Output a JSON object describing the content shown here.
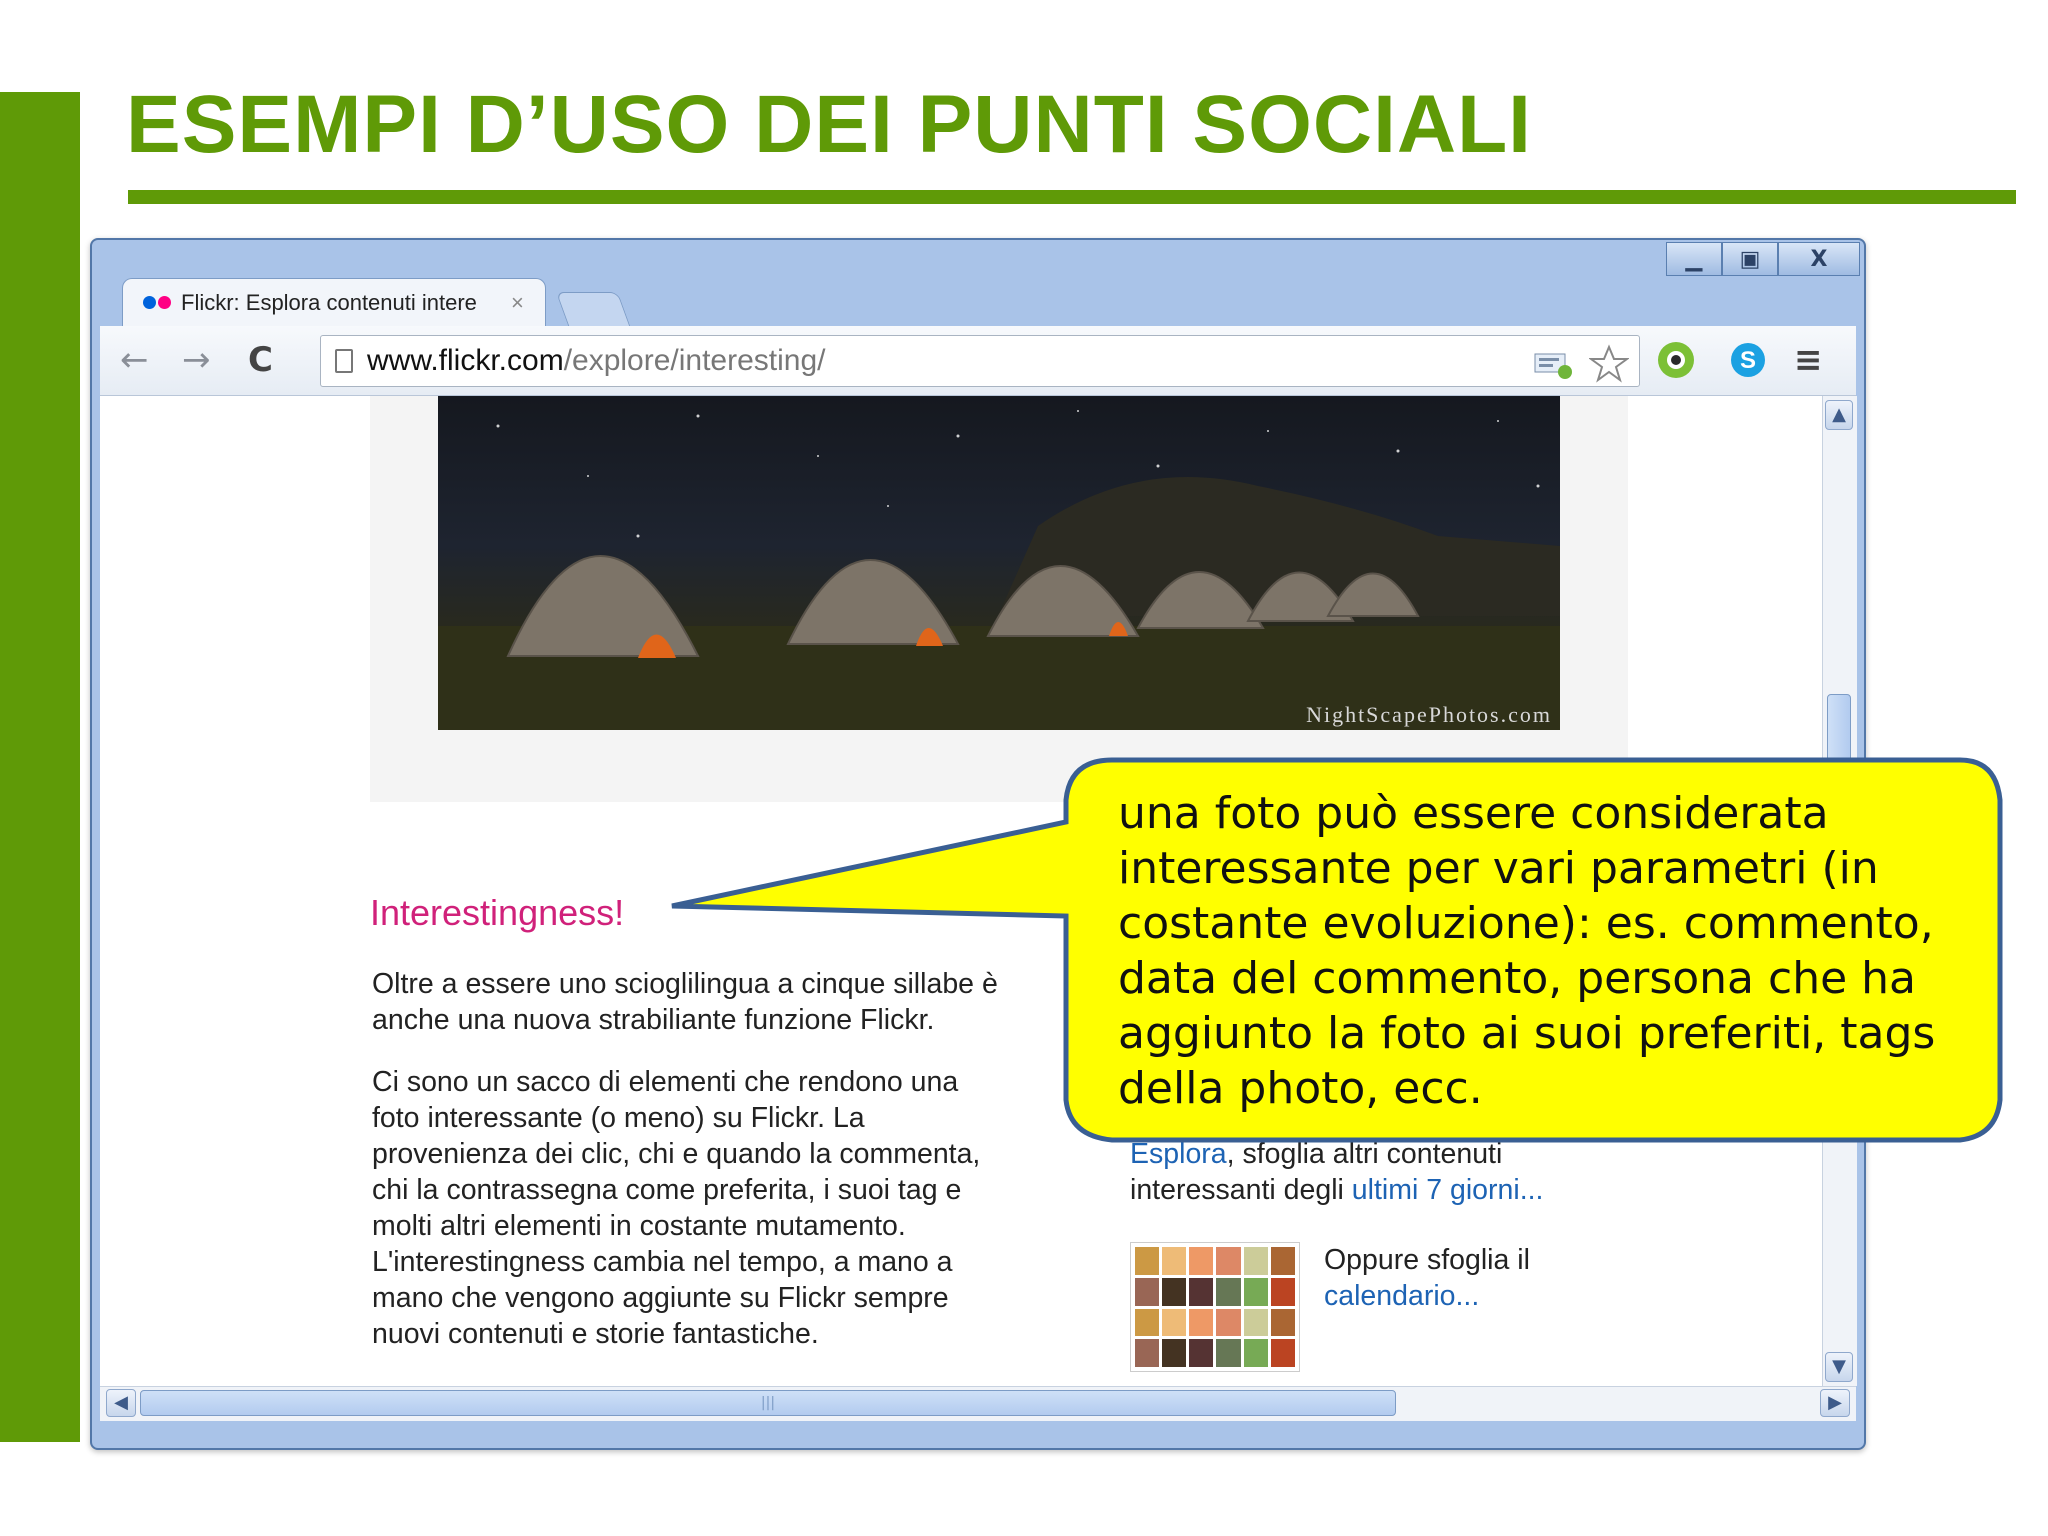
{
  "slide": {
    "title": "ESEMPI D’USO DEI PUNTI SOCIALI",
    "accent_color": "#5f9a07"
  },
  "window": {
    "controls": {
      "minimize": "▁",
      "maximize": "▣",
      "close": "X"
    }
  },
  "tab": {
    "title": "Flickr: Esplora contenuti intere",
    "close": "×",
    "favicon_colors": [
      "#0063dc",
      "#ff0084"
    ]
  },
  "toolbar": {
    "back_icon": "←",
    "forward_icon": "→",
    "reload_icon": "C",
    "url_host": "www.flickr.com",
    "url_path": "/explore/interesting/",
    "menu_icon": "≡"
  },
  "page": {
    "photo_credit": "NightScapePhotos.com",
    "heading": "Interestingness!",
    "para1": "Oltre a essere uno scioglilingua a cinque sillabe è\nanche una nuova strabiliante funzione Flickr.",
    "para2": "Ci sono un sacco di elementi che rendono una\nfoto interessante (o meno) su Flickr. La\nprovenienza dei clic, chi e quando la commenta,\nchi la contrassegna come preferita, i suoi tag e\nmolti altri elementi in costante mutamento.\nL'interestingness cambia nel tempo, a mano a\nmano che vengono aggiunte su Flickr sempre\nnuovi contenuti e storie fantastiche.",
    "explore_link": "Esplora",
    "explore_text": ", sfoglia altri contenuti",
    "recent_prefix": "interessanti degli ",
    "recent_link": "ultimi 7 giorni...",
    "calendar_text": "Oppure sfoglia il",
    "calendar_link": "calendario..."
  },
  "callout": {
    "text": "una foto può essere considerata interessante per vari parametri (in costante evoluzione): es. commento, data del commento, persona che ha aggiunto la foto ai suoi preferiti, tags della photo, ecc.",
    "fill_color": "#ffff00",
    "border_color": "#3a5f93"
  }
}
